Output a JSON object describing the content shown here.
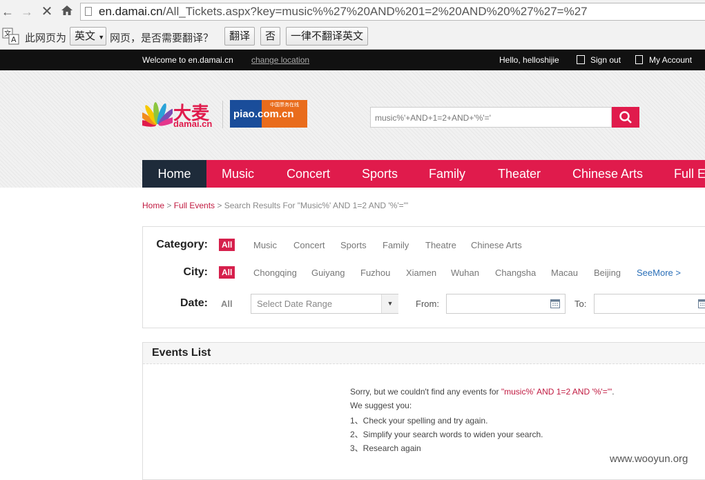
{
  "browser": {
    "url_domain": "en.damai.cn",
    "url_path": "/All_Tickets.aspx?key=music%%27%20AND%201=2%20AND%20%27%27=%27",
    "translate": {
      "lead_text": "此网页为",
      "language": "英文",
      "mid_text": "网页，是否需要翻译？",
      "translate_btn": "翻译",
      "no_btn": "否",
      "never_btn": "一律不翻译英文"
    }
  },
  "topbar": {
    "welcome": "Welcome to en.damai.cn",
    "change_location": "change location",
    "hello": "Hello, helloshijie",
    "sign_out": "Sign out",
    "my_account": "My Account"
  },
  "logo": {
    "damai_cn": "大麦",
    "damai_en": "damai.cn",
    "piao_top": "中国票务在线",
    "piao_text": "piao.com.cn"
  },
  "search": {
    "value": "music%'+AND+1=2+AND+'%'='"
  },
  "nav": [
    "Home",
    "Music",
    "Concert",
    "Sports",
    "Family",
    "Theater",
    "Chinese Arts",
    "Full Events"
  ],
  "breadcrumb": {
    "home": "Home",
    "sep1": " > ",
    "full_events": "Full Events",
    "rest": " > Search Results For \"Music%' AND 1=2 AND '%'='\""
  },
  "filters": {
    "category_label": "Category:",
    "category_all": "All",
    "categories": [
      "Music",
      "Concert",
      "Sports",
      "Family",
      "Theatre",
      "Chinese Arts"
    ],
    "city_label": "City:",
    "city_all": "All",
    "cities": [
      "Chongqing",
      "Guiyang",
      "Fuzhou",
      "Xiamen",
      "Wuhan",
      "Changsha",
      "Macau",
      "Beijing"
    ],
    "see_more": "SeeMore >",
    "date_label": "Date:",
    "date_all": "All",
    "date_range_placeholder": "Select Date Range",
    "from_label": "From:",
    "to_label": "To:"
  },
  "events": {
    "title": "Events List",
    "sorry_prefix": "Sorry, but we couldn't find any events for ",
    "sorry_query": "\"music%' AND 1=2 AND '%'='\"",
    "sorry_suffix": ".",
    "suggest": "We suggest you:",
    "tips": [
      "1、Check your spelling and try again.",
      "2、Simplify your search words to widen your search.",
      "3、Research again"
    ]
  },
  "watermark": "www.wooyun.org",
  "colors": {
    "brand": "#e01b4c",
    "nav_active": "#1e2b3a",
    "topbar": "#111111"
  }
}
